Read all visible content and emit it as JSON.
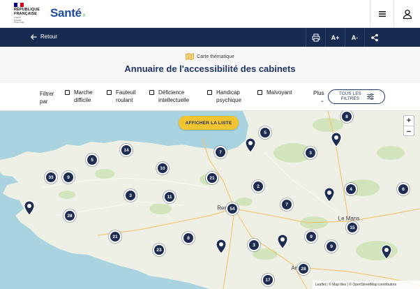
{
  "header": {
    "republic_text_1": "RÉPUBLIQUE",
    "republic_text_2": "FRANÇAISE",
    "motto_1": "Liberté",
    "motto_2": "Égalité",
    "motto_3": "Fraternité",
    "brand": "Santé",
    "brand_suffix": ".fr",
    "flag_colors": [
      "#000091",
      "#ffffff",
      "#e1000f"
    ],
    "menu_icon": "menu-icon",
    "account_icon": "user-icon"
  },
  "toolbar": {
    "back_label": "Retour",
    "increase_text_label": "A+",
    "decrease_text_label": "A-",
    "print_icon": "print-icon",
    "share_icon": "share-icon",
    "background": "#172b50"
  },
  "page": {
    "theme_label": "Carte thématique",
    "title": "Annuaire de l'accessibilité des cabinets"
  },
  "filters": {
    "label_1": "Filtrer",
    "label_2": "par",
    "items": [
      {
        "line1": "Marche",
        "line2": "difficile"
      },
      {
        "line1": "Fauteuil",
        "line2": "roulant"
      },
      {
        "line1": "Déficience",
        "line2": "intellectuelle"
      },
      {
        "line1": "Handicap",
        "line2": "psychique"
      },
      {
        "line1": "Malvoyant",
        "line2": ""
      }
    ],
    "more_label": "Plus",
    "all_filters_line1": "TOUS LES",
    "all_filters_line2": "FILTRES"
  },
  "map": {
    "show_list_label": "AFFICHER LA LISTE",
    "zoom_in": "+",
    "zoom_out": "−",
    "attribution": "Leaflet | © Map tiles | © OpenStreetMap contributors",
    "clusters": [
      "5",
      "14",
      "7",
      "5",
      "10",
      "33",
      "9",
      "21",
      "2",
      "8",
      "4",
      "6",
      "3",
      "11",
      "7",
      "28",
      "54",
      "9",
      "15",
      "21",
      "8",
      "3",
      "23",
      "28",
      "17",
      "3",
      "9"
    ],
    "cities": [
      "Rennes",
      "Le Mans",
      "Angers"
    ],
    "marker_color": "#1d2d52",
    "cta_color": "#f4c430"
  }
}
